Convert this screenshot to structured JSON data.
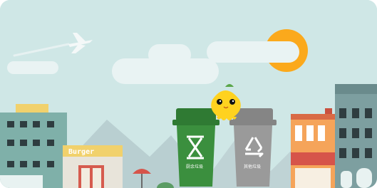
{
  "colors": {
    "sky": "#cfe7e6",
    "sun": "#fba91c",
    "cloud": "#e9f3f3",
    "mountain": "#b9cfd1",
    "left_building": "#7fb0a9",
    "burger_shop": "#f1d16c",
    "right_building": "#7d9fa0",
    "orange_house": "#f5a45a",
    "food_bin": "#3b8f3e",
    "other_bin": "#9a9a9a",
    "mascot": "#ffd21f"
  },
  "scene": {
    "shop_sign": "Burger",
    "bins": [
      {
        "label": "厨余垃圾",
        "icon": "hourglass-icon",
        "color": "#3b8f3e"
      },
      {
        "label": "其他垃圾",
        "icon": "recycle-icon",
        "color": "#9a9a9a"
      }
    ],
    "mascot": "lemon-mascot"
  }
}
